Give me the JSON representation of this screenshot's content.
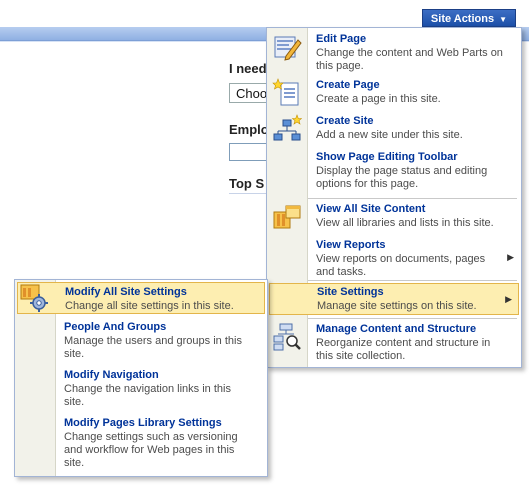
{
  "site_actions": {
    "label": "Site Actions",
    "arrow": "▼"
  },
  "background": {
    "label1": "I need",
    "select_value": "Choo",
    "label2": "Emplo",
    "label3": "Top S"
  },
  "main_menu": {
    "items": [
      {
        "title": "Edit Page",
        "desc": "Change the content and Web Parts on this page.",
        "icon": "edit-page-icon"
      },
      {
        "title": "Create Page",
        "desc": "Create a page in this site.",
        "icon": "create-page-icon"
      },
      {
        "title": "Create Site",
        "desc": "Add a new site under this site.",
        "icon": "create-site-icon"
      },
      {
        "title": "Show Page Editing Toolbar",
        "desc": "Display the page status and editing options for this page.",
        "icon": "toolbar-icon"
      },
      {
        "title": "View All Site Content",
        "desc": "View all libraries and lists in this site.",
        "icon": "view-all-content-icon"
      },
      {
        "title": "View Reports",
        "desc": "View reports on documents, pages and tasks.",
        "icon": "reports-icon"
      },
      {
        "title": "Site Settings",
        "desc": "Manage site settings on this site.",
        "icon": "site-settings-icon"
      },
      {
        "title": "Manage Content and Structure",
        "desc": "Reorganize content and structure in this site collection.",
        "icon": "manage-content-icon"
      }
    ],
    "submenu_arrow": "▶"
  },
  "sub_menu": {
    "items": [
      {
        "title": "Modify All Site Settings",
        "desc": "Change all site settings in this site.",
        "icon": "settings-gear-icon"
      },
      {
        "title": "People And Groups",
        "desc": "Manage the users and groups in this site."
      },
      {
        "title": "Modify Navigation",
        "desc": "Change the navigation links in this site."
      },
      {
        "title": "Modify Pages Library Settings",
        "desc": "Change settings such as versioning and workflow for Web pages in this site."
      }
    ]
  }
}
